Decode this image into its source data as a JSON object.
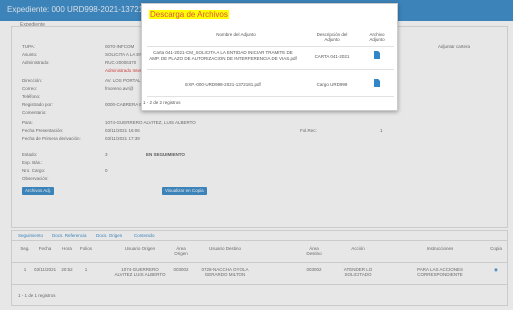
{
  "window": {
    "title": "Expediente: 000 URD998-2021-1372181"
  },
  "expediente": {
    "legend": "Expediente",
    "fields": [
      {
        "label": "TUPA:",
        "value": "0070-INFCOM"
      },
      {
        "label": "Asunto:",
        "value": "SOLICITA A LA EN"
      },
      {
        "label": "Administrado:",
        "value": "RUC-20006370"
      },
      {
        "label": "",
        "value": "Administrado Interferencia"
      },
      {
        "label": "Dirección:",
        "value": "AV. LOS PORTALES"
      },
      {
        "label": "Correo:",
        "value": "fmoreno.avr@"
      },
      {
        "label": "Teléfono:",
        "value": ""
      },
      {
        "label": "Registrado por:",
        "value": "0000-CABRERA ESTELA ROBERTO IBORG"
      },
      {
        "label": "Comentario:",
        "value": ""
      },
      {
        "label": "Para:",
        "value": "1074-GUERRERO ALVITEZ, LUIS ALBERTO"
      },
      {
        "label": "Fecha Presentación:",
        "value": "03/11/2021 16:06"
      },
      {
        "label": "Fecha de Primera derivación:",
        "value": "03/11/2021 17:39"
      },
      {
        "label": "Estado:",
        "value": "3"
      },
      {
        "label": "Exp. Bás.:",
        "value": ""
      },
      {
        "label": "Nro. Cargo:",
        "value": "0"
      },
      {
        "label": "Observación:",
        "value": ""
      }
    ],
    "estado_text": "EN SEGUIMIENTO",
    "folios_label": "Fol.Rec:",
    "folios_value": "1",
    "tupa_right": "Adjuntar cartera",
    "btn_archivos": "Archivos Adj.",
    "btn_copia": "Visualizar en Copia"
  },
  "tabs": {
    "items": [
      "Seguimiento",
      "Docs. Referencia",
      "Docs. Origen",
      "Contenido"
    ],
    "columns": [
      "Seg.",
      "Fecha",
      "Hora",
      "Folios",
      "Usuario Origen",
      "Área Origen",
      "Usuario Destino",
      "Área Destino",
      "Acción",
      "Instrucciones",
      "Copia"
    ],
    "row": [
      "1",
      "03/11/2021",
      "20:52",
      "1",
      "1074-GUERRERO ALVITEZ LUIS ALBERTO",
      "003002",
      "0728-NACCHA OYOLA GERARDO MILTON",
      "003002",
      "ATENDER LO SOLICITADO",
      "PARA LAS ACCIONES CORRESPONDIENTE",
      "◉"
    ],
    "footer": "1 - 1 de 1 registros"
  },
  "modal": {
    "title": "Descarga de Archivos",
    "headers": [
      "Nombre del Adjunto",
      "Descripción del Adjunto",
      "Archivo Adjunto"
    ],
    "rows": [
      {
        "name": "Carta 041-2021-CM_SOLICITA A LA ENTIDAD INICIAR TRAMITE DE AMP. DE PLAZO DE AUTORIZACION DE INTERFERENCIA DE VIAS.pdf",
        "desc": "CARTA 041-2021",
        "icon": "file-icon"
      },
      {
        "name": "EXP.-000-URD998-2021-1372181.pdf",
        "desc": "Cargo URD999",
        "icon": "file-icon"
      }
    ],
    "footer": "1 - 2 de 2 registros"
  }
}
